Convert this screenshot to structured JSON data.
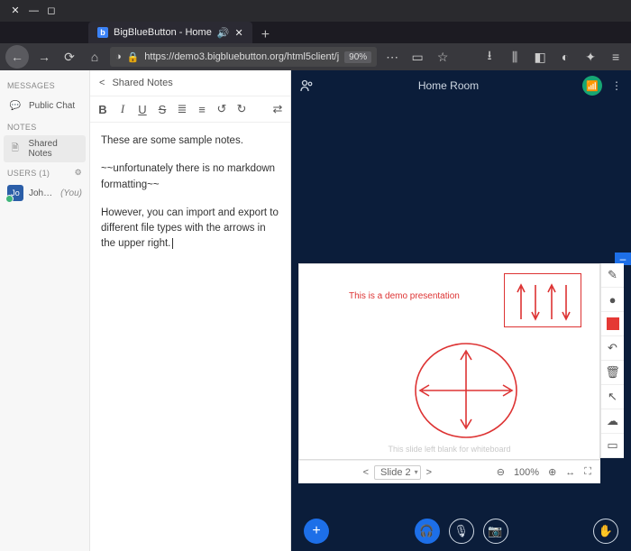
{
  "browser": {
    "tab_title": "BigBlueButton - Home",
    "url": "https://demo3.bigbluebutton.org/html5client/j",
    "zoom": "90%"
  },
  "sidebar": {
    "messages_header": "MESSAGES",
    "public_chat": "Public Chat",
    "notes_header": "NOTES",
    "shared_notes": "Shared Notes",
    "users_header": "USERS (1)",
    "user_initials": "Jo",
    "user_name": "John Per…",
    "user_you": "(You)"
  },
  "notes": {
    "title": "Shared Notes",
    "para1": "These are some sample notes.",
    "para2": "~~unfortunately there is no markdown formatting~~",
    "para3": "However, you can import and export to different file types with the arrows in the upper right."
  },
  "room": {
    "title": "Home Room"
  },
  "presentation": {
    "demo_text": "This is a demo presentation",
    "footer_text": "This slide left blank for whiteboard",
    "slide_label": "Slide 2",
    "zoom_label": "100%"
  }
}
